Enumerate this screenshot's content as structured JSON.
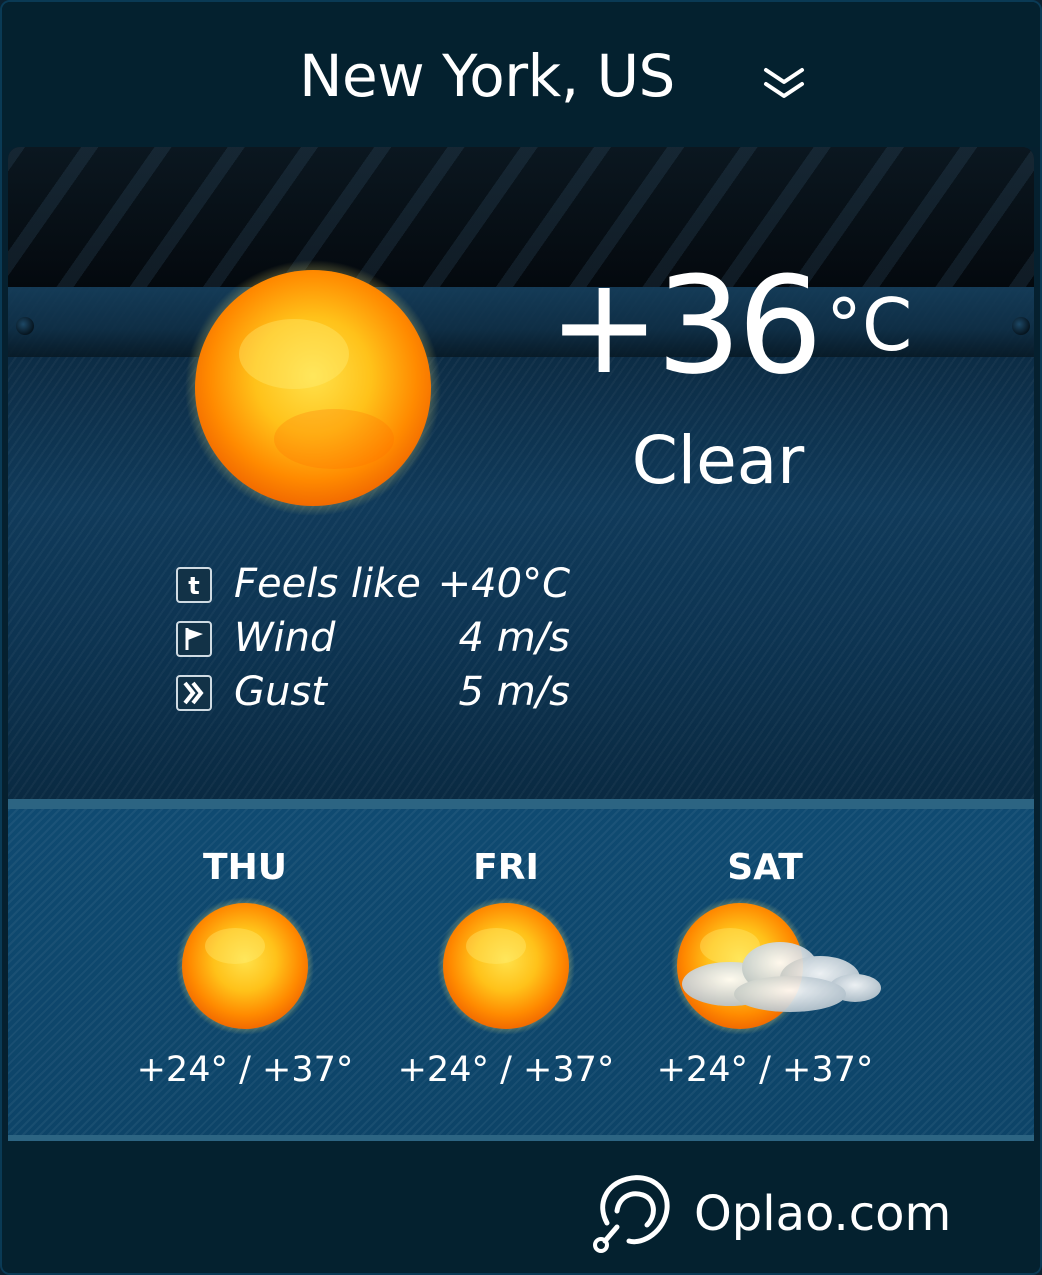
{
  "header": {
    "city": "New York, US",
    "dropdown_icon": "chevron-double-down-icon"
  },
  "current": {
    "temperature": "+36",
    "unit": "°C",
    "condition": "Clear",
    "condition_icon": "sun-icon",
    "details": [
      {
        "icon": "temperature-feel-icon",
        "label": "Feels like",
        "value": "+40°C"
      },
      {
        "icon": "wind-flag-icon",
        "label": "Wind",
        "value": "4 m/s"
      },
      {
        "icon": "gust-icon",
        "label": "Gust",
        "value": "5 m/s"
      }
    ]
  },
  "forecast": [
    {
      "day": "THU",
      "icon": "sun-icon",
      "temps": "+24° / +37°"
    },
    {
      "day": "FRI",
      "icon": "sun-icon",
      "temps": "+24° / +37°"
    },
    {
      "day": "SAT",
      "icon": "sun-cloud-icon",
      "temps": "+24° / +37°"
    }
  ],
  "footer": {
    "brand": "Oplao.com",
    "logo_icon": "oplao-logo-icon"
  },
  "colors": {
    "background": "#05202f",
    "panel_blue": "#0f4a71",
    "text": "#ffffff",
    "sun_core": "#ffb000"
  }
}
